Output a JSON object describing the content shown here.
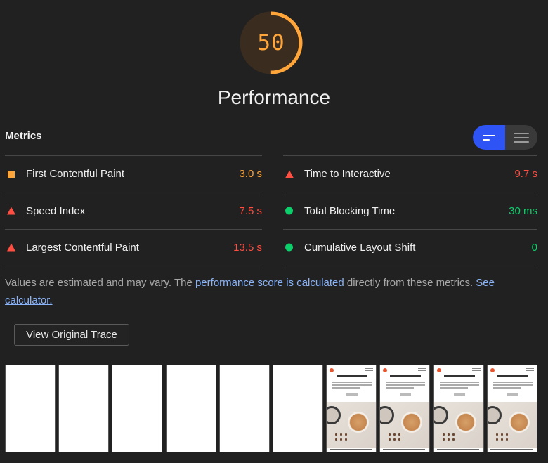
{
  "score": {
    "value": "50",
    "fraction": 0.5,
    "color": "#ffa53a",
    "title": "Performance"
  },
  "metrics": {
    "heading": "Metrics",
    "toggle": {
      "active": "opportunity-view",
      "options": [
        "bars-view",
        "list-view"
      ]
    },
    "left": [
      {
        "label": "First Contentful Paint",
        "value": "3.0 s",
        "status": "average"
      },
      {
        "label": "Speed Index",
        "value": "7.5 s",
        "status": "fail"
      },
      {
        "label": "Largest Contentful Paint",
        "value": "13.5 s",
        "status": "fail"
      }
    ],
    "right": [
      {
        "label": "Time to Interactive",
        "value": "9.7 s",
        "status": "fail"
      },
      {
        "label": "Total Blocking Time",
        "value": "30 ms",
        "status": "pass"
      },
      {
        "label": "Cumulative Layout Shift",
        "value": "0",
        "status": "pass"
      }
    ]
  },
  "note": {
    "prefix": "Values are estimated and may vary. The ",
    "link1": "performance score is calculated",
    "middle": " directly from these metrics. ",
    "link2": "See calculator."
  },
  "trace_button": "View Original Trace",
  "filmstrip": {
    "frames": [
      "blank",
      "blank",
      "blank",
      "blank",
      "blank",
      "blank",
      "loaded",
      "loaded",
      "loaded",
      "loaded"
    ]
  },
  "colors": {
    "average": "#ffa53a",
    "fail": "#ff4e42",
    "pass": "#0cce6b",
    "accent": "#2f54f6"
  }
}
